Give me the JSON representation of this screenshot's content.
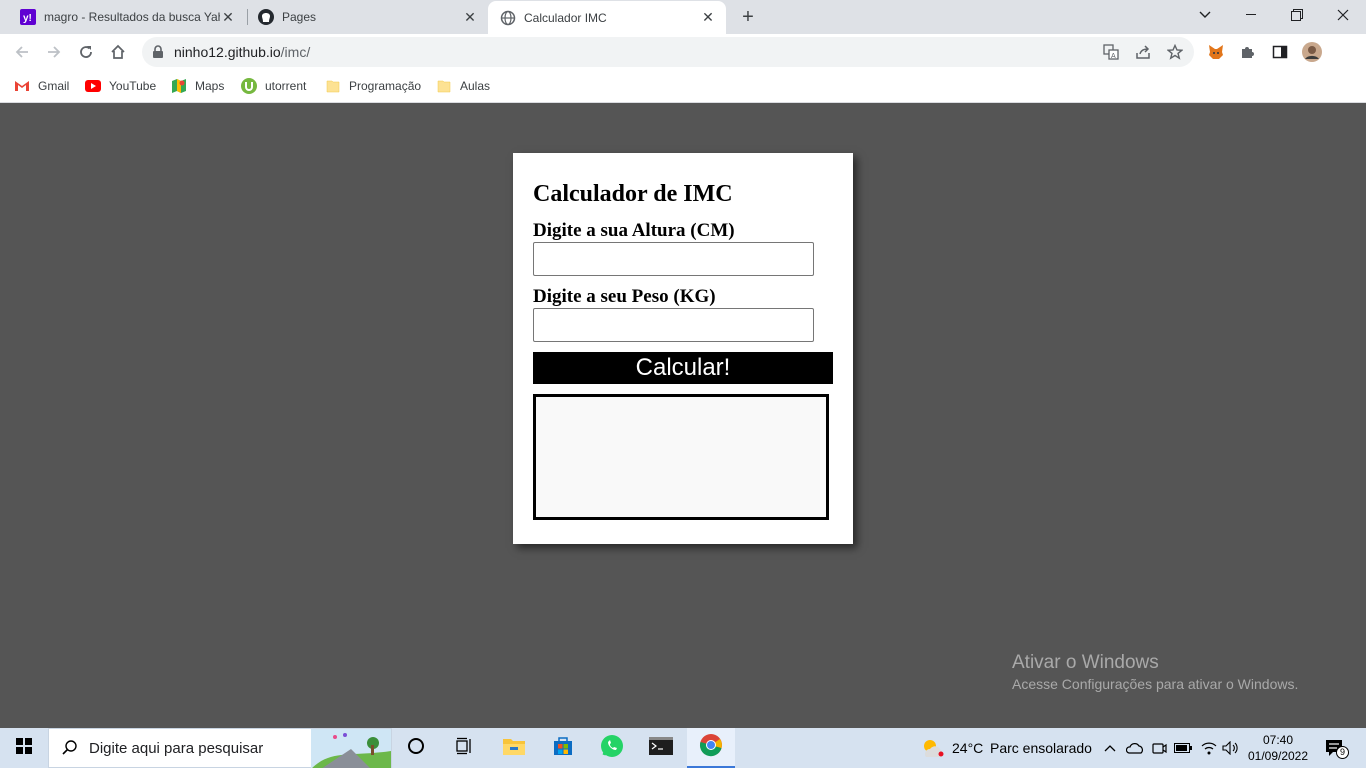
{
  "browser": {
    "tabs": [
      {
        "title": "magro - Resultados da busca Yah",
        "icon": "yahoo-icon",
        "active": false
      },
      {
        "title": "Pages",
        "icon": "github-icon",
        "active": false
      },
      {
        "title": "Calculador IMC",
        "icon": "globe-icon",
        "active": true
      }
    ],
    "url_host": "ninho12.github.io",
    "url_path": "/imc/",
    "bookmarks": [
      {
        "label": "Gmail",
        "icon": "gmail-icon"
      },
      {
        "label": "YouTube",
        "icon": "youtube-icon"
      },
      {
        "label": "Maps",
        "icon": "maps-icon"
      },
      {
        "label": "utorrent",
        "icon": "utorrent-icon"
      },
      {
        "label": "Programação",
        "icon": "folder-icon"
      },
      {
        "label": "Aulas",
        "icon": "folder-icon"
      }
    ]
  },
  "page": {
    "title": "Calculador de IMC",
    "height_label": "Digite a sua Altura (CM)",
    "height_value": "",
    "weight_label": "Digite a seu Peso (KG)",
    "weight_value": "",
    "calc_button": "Calcular!",
    "result": ""
  },
  "watermark": {
    "line1": "Ativar o Windows",
    "line2": "Acesse Configurações para ativar o Windows."
  },
  "taskbar": {
    "search_placeholder": "Digite aqui para pesquisar",
    "weather_temp": "24°C",
    "weather_desc": "Parc ensolarado",
    "time": "07:40",
    "date": "01/09/2022",
    "notification_count": "9"
  }
}
